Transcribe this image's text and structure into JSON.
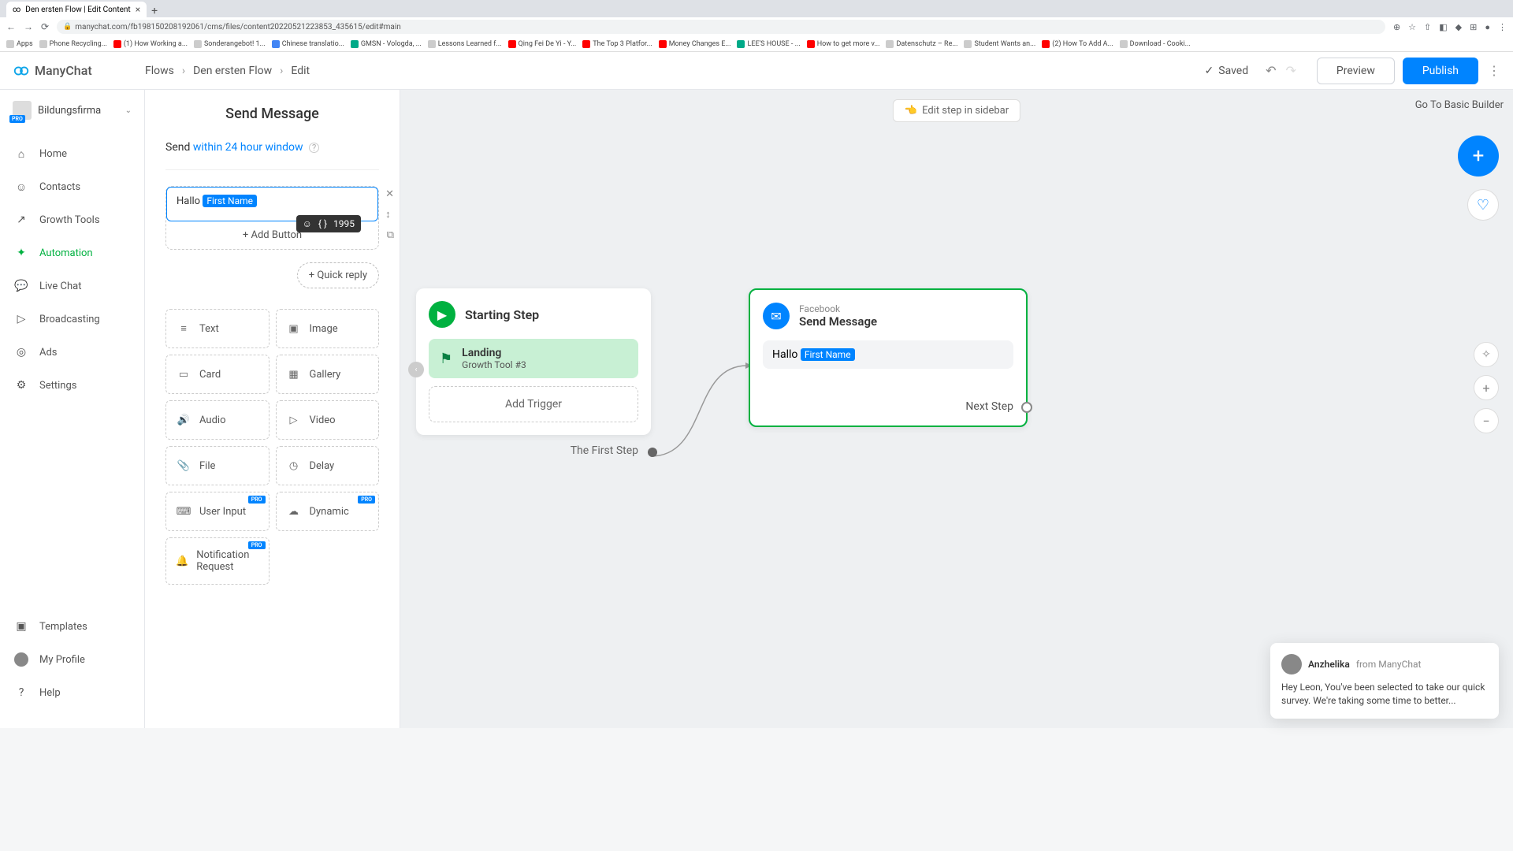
{
  "browser": {
    "tab_title": "Den ersten Flow | Edit Content",
    "url": "manychat.com/fb198150208192061/cms/files/content20220521223853_435615/edit#main",
    "bookmarks": [
      {
        "label": "Apps"
      },
      {
        "label": "Phone Recycling..."
      },
      {
        "label": "(1) How Working a..."
      },
      {
        "label": "Sonderangebot! 1..."
      },
      {
        "label": "Chinese translatio..."
      },
      {
        "label": "GMSN - Vologda, ..."
      },
      {
        "label": "Lessons Learned f..."
      },
      {
        "label": "Qing Fei De Yi - Y..."
      },
      {
        "label": "The Top 3 Platfor..."
      },
      {
        "label": "Money Changes E..."
      },
      {
        "label": "LEE'S HOUSE - ..."
      },
      {
        "label": "How to get more v..."
      },
      {
        "label": "Datenschutz – Re..."
      },
      {
        "label": "Student Wants an..."
      },
      {
        "label": "(2) How To Add A..."
      },
      {
        "label": "Download - Cooki..."
      }
    ]
  },
  "header": {
    "logo": "ManyChat",
    "breadcrumbs": [
      "Flows",
      "Den ersten Flow",
      "Edit"
    ],
    "saved": "Saved",
    "preview": "Preview",
    "publish": "Publish"
  },
  "sidebar": {
    "workspace": "Bildungsfirma",
    "ws_badge": "PRO",
    "items": [
      {
        "label": "Home"
      },
      {
        "label": "Contacts"
      },
      {
        "label": "Growth Tools"
      },
      {
        "label": "Automation"
      },
      {
        "label": "Live Chat"
      },
      {
        "label": "Broadcasting"
      },
      {
        "label": "Ads"
      },
      {
        "label": "Settings"
      }
    ],
    "bottom": [
      {
        "label": "Templates"
      },
      {
        "label": "My Profile"
      },
      {
        "label": "Help"
      }
    ]
  },
  "panel": {
    "title": "Send Message",
    "send_prefix": "Send ",
    "send_link": "within 24 hour window",
    "text_prefix": "Hallo ",
    "text_var": "First Name",
    "char_count": "1995",
    "add_button": "+ Add Button",
    "quick_reply": "+ Quick reply",
    "types": [
      {
        "label": "Text"
      },
      {
        "label": "Image"
      },
      {
        "label": "Card"
      },
      {
        "label": "Gallery"
      },
      {
        "label": "Audio"
      },
      {
        "label": "Video"
      },
      {
        "label": "File"
      },
      {
        "label": "Delay"
      },
      {
        "label": "User Input",
        "pro": true
      },
      {
        "label": "Dynamic",
        "pro": true
      },
      {
        "label": "Notification Request",
        "pro": true
      }
    ]
  },
  "canvas": {
    "edit_hint": "Edit step in sidebar",
    "goto_basic": "Go To Basic Builder",
    "start": {
      "title": "Starting Step",
      "landing_title": "Landing",
      "landing_sub": "Growth Tool #3",
      "add_trigger": "Add Trigger",
      "first_step": "The First Step"
    },
    "send": {
      "subtitle": "Facebook",
      "title": "Send Message",
      "msg_prefix": "Hallo ",
      "msg_var": "First Name",
      "next": "Next Step"
    }
  },
  "chat": {
    "name": "Anzhelika",
    "from": " from ManyChat",
    "body": "Hey Leon,   You've been selected to take our quick survey. We're taking some time to better..."
  }
}
